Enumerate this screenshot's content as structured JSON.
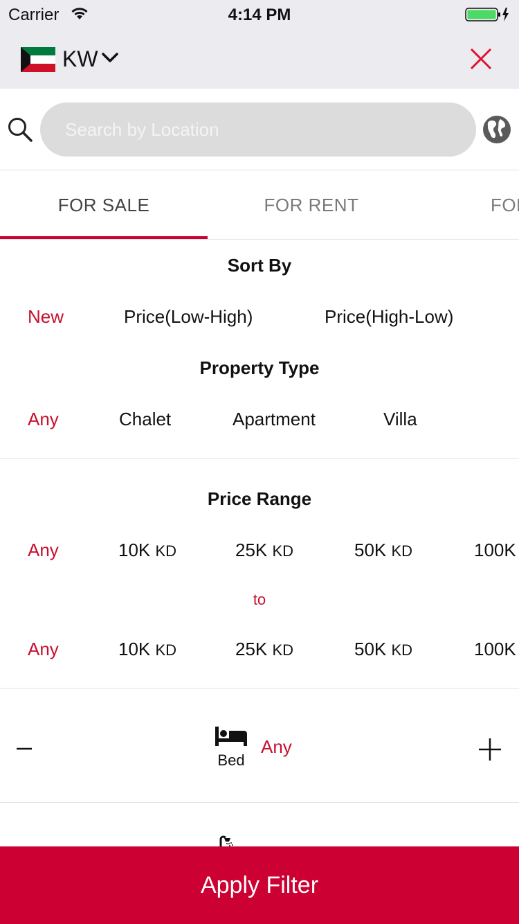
{
  "status_bar": {
    "carrier": "Carrier",
    "time": "4:14 PM"
  },
  "header": {
    "country_code": "KW"
  },
  "search": {
    "placeholder": "Search by Location"
  },
  "tabs": [
    {
      "label": "FOR SALE",
      "active": true
    },
    {
      "label": "FOR RENT",
      "active": false
    },
    {
      "label": "FOR S",
      "active": false
    }
  ],
  "sort_by": {
    "title": "Sort By",
    "options": [
      "New",
      "Price(Low-High)",
      "Price(High-Low)"
    ],
    "selected": "New"
  },
  "property_type": {
    "title": "Property Type",
    "options": [
      "Any",
      "Chalet",
      "Apartment",
      "Villa"
    ],
    "selected": "Any"
  },
  "price_range": {
    "title": "Price Range",
    "currency": "KD",
    "from_options": [
      {
        "value": "Any",
        "unit": ""
      },
      {
        "value": "10K",
        "unit": "KD"
      },
      {
        "value": "25K",
        "unit": "KD"
      },
      {
        "value": "50K",
        "unit": "KD"
      },
      {
        "value": "100K",
        "unit": ""
      }
    ],
    "to_label": "to",
    "to_options": [
      {
        "value": "Any",
        "unit": ""
      },
      {
        "value": "10K",
        "unit": "KD"
      },
      {
        "value": "25K",
        "unit": "KD"
      },
      {
        "value": "50K",
        "unit": "KD"
      },
      {
        "value": "100K",
        "unit": ""
      }
    ],
    "selected_from": "Any",
    "selected_to": "Any"
  },
  "bed": {
    "label": "Bed",
    "value": "Any"
  },
  "footer": {
    "apply_label": "Apply Filter"
  },
  "colors": {
    "accent": "#cc0033",
    "header_bg": "#ebebf0",
    "search_bg": "#dcdcdc"
  },
  "icons": [
    "wifi-icon",
    "battery-icon",
    "kuwait-flag-icon",
    "chevron-down-icon",
    "close-icon",
    "search-icon",
    "globe-icon",
    "bed-icon",
    "shower-icon",
    "minus-icon",
    "plus-icon"
  ]
}
